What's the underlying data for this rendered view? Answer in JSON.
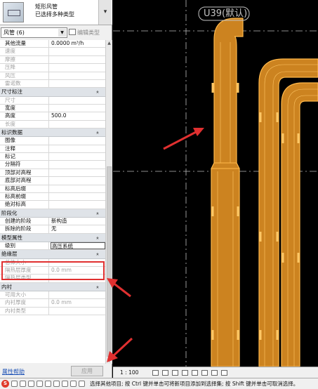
{
  "type_selector": {
    "name": "矩形风管",
    "subtitle": "已选择多种类型"
  },
  "filter": {
    "selected": "风管 (6)",
    "edit_type_label": "编辑类型"
  },
  "groups": [
    {
      "title": null,
      "rows": [
        {
          "label": "其他流量",
          "value": "0.0000 m³/h",
          "disabled": false
        },
        {
          "label": "速度",
          "value": "",
          "disabled": true
        },
        {
          "label": "摩擦",
          "value": "",
          "disabled": true
        },
        {
          "label": "压降",
          "value": "",
          "disabled": true
        },
        {
          "label": "风压",
          "value": "",
          "disabled": true
        },
        {
          "label": "雷诺数",
          "value": "",
          "disabled": true
        }
      ]
    },
    {
      "title": "尺寸标注",
      "rows": [
        {
          "label": "尺寸",
          "value": "",
          "disabled": true
        },
        {
          "label": "宽度",
          "value": "",
          "disabled": false
        },
        {
          "label": "高度",
          "value": "500.0",
          "disabled": false
        },
        {
          "label": "长度",
          "value": "",
          "disabled": true
        }
      ]
    },
    {
      "title": "标识数据",
      "rows": [
        {
          "label": "图像",
          "value": "",
          "disabled": false
        },
        {
          "label": "注释",
          "value": "",
          "disabled": false
        },
        {
          "label": "标记",
          "value": "",
          "disabled": false
        },
        {
          "label": "分隔符",
          "value": "",
          "disabled": false
        },
        {
          "label": "顶部对高程",
          "value": "",
          "disabled": false
        },
        {
          "label": "底部对高程",
          "value": "",
          "disabled": false
        },
        {
          "label": "标高后缀",
          "value": "",
          "disabled": false
        },
        {
          "label": "标高前缀",
          "value": "",
          "disabled": false
        },
        {
          "label": "绝对标高",
          "value": "",
          "disabled": false
        }
      ]
    },
    {
      "title": "阶段化",
      "rows": [
        {
          "label": "创建的阶段",
          "value": "新构造",
          "disabled": false
        },
        {
          "label": "拆除的阶段",
          "value": "无",
          "disabled": false
        }
      ]
    },
    {
      "title": "模型属性",
      "rows": [
        {
          "label": "级别",
          "value": "高压系统",
          "disabled": false,
          "editing": true
        }
      ]
    },
    {
      "title": "绝缘层",
      "rows": [
        {
          "label": "总体大小",
          "value": "",
          "disabled": true
        },
        {
          "label": "隔热层厚度",
          "value": "0.0 mm",
          "disabled": true
        },
        {
          "label": "隔热层类型",
          "value": "",
          "disabled": true
        }
      ]
    },
    {
      "title": "内衬",
      "rows": [
        {
          "label": "可用大小",
          "value": "",
          "disabled": true
        },
        {
          "label": "内衬厚度",
          "value": "0.0 mm",
          "disabled": true
        },
        {
          "label": "内衬类型",
          "value": "",
          "disabled": true
        }
      ]
    }
  ],
  "footer": {
    "help_label": "属性帮助",
    "apply_label": "应用"
  },
  "canvas": {
    "view_tag": "U39(默认)",
    "duct_color": "#d98c1e",
    "annotation_color": "#e03030"
  },
  "view_bar": {
    "scale": "1 : 100"
  },
  "status": {
    "text": "选择其他项目; 按 Ctrl 键并单击可将新项目添加到选择集; 按 Shift 键并单击可取消选择。"
  }
}
